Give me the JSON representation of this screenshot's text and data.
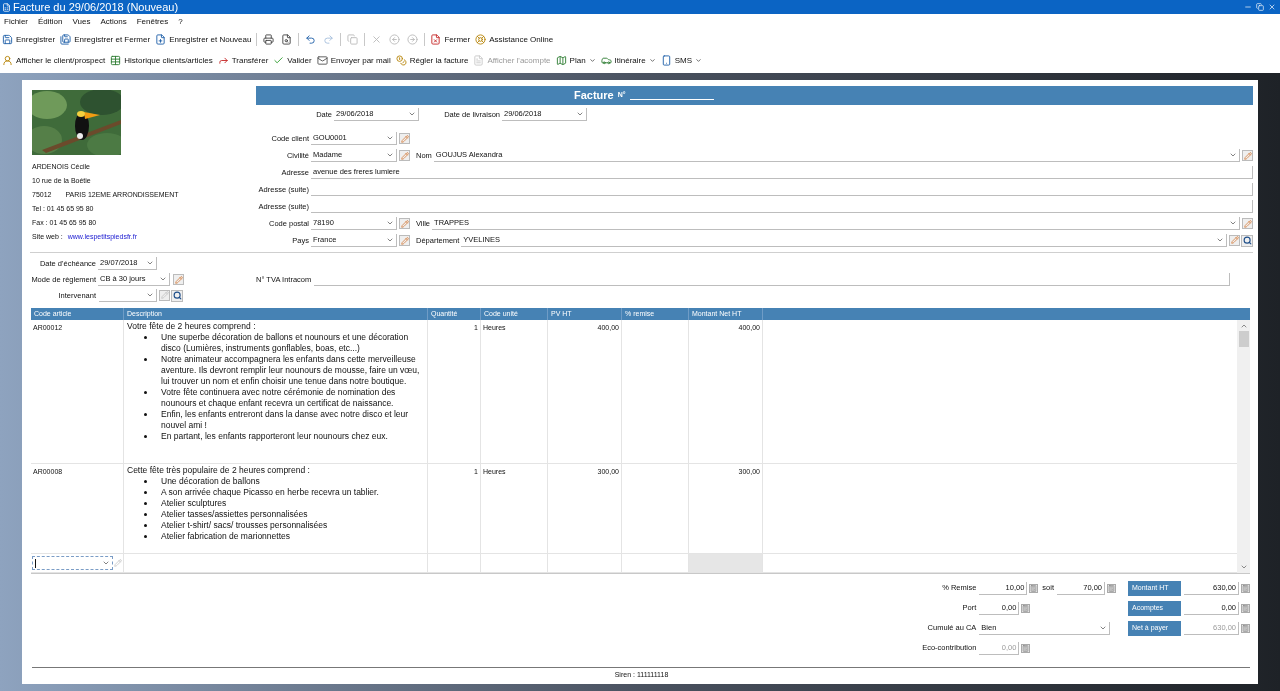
{
  "window": {
    "title": "Facture du 29/06/2018 (Nouveau)"
  },
  "menu": [
    "Fichier",
    "Édition",
    "Vues",
    "Actions",
    "Fenêtres",
    "?"
  ],
  "toolbar": [
    {
      "kind": "button",
      "label": "Enregistrer",
      "disabled": false
    },
    {
      "kind": "button",
      "label": "Enregistrer et Fermer",
      "disabled": false
    },
    {
      "kind": "button",
      "label": "Enregistrer et Nouveau",
      "disabled": false
    },
    {
      "kind": "separator"
    },
    {
      "kind": "icon",
      "disabled": false
    },
    {
      "kind": "icon",
      "disabled": false
    },
    {
      "kind": "separator"
    },
    {
      "kind": "icon",
      "disabled": false
    },
    {
      "kind": "icon",
      "disabled": true
    },
    {
      "kind": "separator"
    },
    {
      "kind": "icon",
      "disabled": true
    },
    {
      "kind": "separator"
    },
    {
      "kind": "icon",
      "disabled": true
    },
    {
      "kind": "icon",
      "disabled": true
    },
    {
      "kind": "icon",
      "disabled": true
    },
    {
      "kind": "separator"
    },
    {
      "kind": "button",
      "label": "Fermer",
      "disabled": false
    },
    {
      "kind": "button",
      "label": "Assistance Online",
      "disabled": false
    }
  ],
  "toolbar_2": [
    {
      "kind": "button",
      "label": "Afficher le client/prospect",
      "disabled": false
    },
    {
      "kind": "button",
      "label": "Historique clients/articles",
      "disabled": false
    },
    {
      "kind": "button",
      "label": "Transférer",
      "disabled": false
    },
    {
      "kind": "button",
      "label": "Valider",
      "disabled": false
    },
    {
      "kind": "button",
      "label": "Envoyer par mail",
      "disabled": false
    },
    {
      "kind": "button",
      "label": "Régler la facture",
      "disabled": false
    },
    {
      "kind": "button",
      "label": "Afficher l'acompte",
      "disabled": true
    },
    {
      "kind": "dropdown",
      "label": "Plan",
      "disabled": false
    },
    {
      "kind": "dropdown",
      "label": "Itinéraire",
      "disabled": false
    },
    {
      "kind": "dropdown",
      "label": "SMS",
      "disabled": false
    }
  ],
  "company": {
    "name": "ARDENOIS Cécile",
    "street": "10 rue de la Boétie",
    "postcode": "75012",
    "city": "PARIS 12EME ARRONDISSEMENT",
    "phone": "Tel :  01 45 65 95 80",
    "fax": "Fax :  01 45 65 95 80",
    "website_label": "Site web :",
    "website": "www.lespetitspiedsfr.fr"
  },
  "invoice": {
    "title": "Facture",
    "number_label": "N°",
    "date": {
      "label": "Date",
      "value": "29/06/2018"
    },
    "delivery_date": {
      "label": "Date de livraison",
      "value": "29/06/2018"
    }
  },
  "client": {
    "code": {
      "label": "Code client",
      "value": "GOU0001"
    },
    "civility": {
      "label": "Civilité",
      "value": "Madame"
    },
    "name": {
      "label": "Nom",
      "value": "GOUJUS Alexandra"
    },
    "address": {
      "label": "Adresse",
      "value": "avenue des freres lumiere"
    },
    "address_2": {
      "label": "Adresse (suite)"
    },
    "address_3": {
      "label": "Adresse (suite)"
    },
    "postcode": {
      "label": "Code postal",
      "value": "78190"
    },
    "city": {
      "label": "Ville",
      "value": "TRAPPES"
    },
    "country": {
      "label": "Pays",
      "value": "France"
    },
    "department": {
      "label": "Département",
      "value": "YVELINES"
    }
  },
  "payment": {
    "due_date": {
      "label": "Date d'échéance",
      "value": "29/07/2018"
    },
    "mode": {
      "label": "Mode de règlement",
      "value": "CB à 30 jours",
      "edit_disabled": false
    },
    "agent": {
      "label": "Intervenant",
      "edit_disabled": true
    },
    "vat_number": {
      "label": "N° TVA Intracom"
    }
  },
  "table": {
    "columns": [
      "Code article",
      "Description",
      "Quantité",
      "Code unité",
      "PV HT",
      "% remise",
      "Montant Net HT"
    ],
    "rows": [
      {
        "code": "AR00012",
        "description": {
          "intro": "Votre fête de 2 heures comprend :",
          "bullets": [
            "Une superbe décoration de ballons et nounours et une décoration disco (Lumières, instruments gonflables, boas, etc...)",
            "Notre animateur accompagnera les enfants dans cette merveilleuse aventure. Ils devront remplir leur nounours de mousse, faire un vœu, lui trouver un nom et enfin choisir une tenue dans notre boutique.",
            "Votre fête continuera avec notre cérémonie de nomination des nounours et chaque enfant recevra un certificat de naissance.",
            "Enfin, les enfants entreront dans la danse avec notre disco et leur nouvel ami !",
            "En partant, les enfants rapporteront leur nounours chez eux."
          ]
        },
        "quantity": "1",
        "unit": "Heures",
        "price": "400,00",
        "amount": "400,00"
      },
      {
        "code": "AR00008",
        "description": {
          "intro": "Cette fête très populaire de 2 heures comprend :",
          "bullets": [
            "Une décoration de ballons",
            "A son arrivée chaque Picasso en herbe recevra un tablier.",
            "Atelier sculptures",
            "Atelier tasses/assiettes personnalisées",
            "Atelier t-shirt/ sacs/ trousses personnalisées",
            "Atelier fabrication de marionnettes"
          ]
        },
        "quantity": "1",
        "unit": "Heures",
        "price": "300,00",
        "amount": "300,00"
      }
    ]
  },
  "totals": {
    "discount": {
      "label": "% Remise",
      "value": "10,00"
    },
    "discount_amount": {
      "label": "soit",
      "value": "70,00"
    },
    "shipping": {
      "label": "Port",
      "value": "0,00"
    },
    "revenue": {
      "label": "Cumulé au CA",
      "value": "Bien"
    },
    "eco": {
      "label": "Eco-contribution",
      "value": "0,00",
      "disabled": true
    },
    "total_ht": {
      "label": "Montant HT",
      "value": "630,00",
      "disabled": false
    },
    "deposits": {
      "label": "Acomptes",
      "value": "0,00",
      "disabled": false
    },
    "net": {
      "label": "Net à payer",
      "value": "630,00",
      "disabled": true
    }
  },
  "footer": {
    "siren": "Siren : 111111118"
  }
}
